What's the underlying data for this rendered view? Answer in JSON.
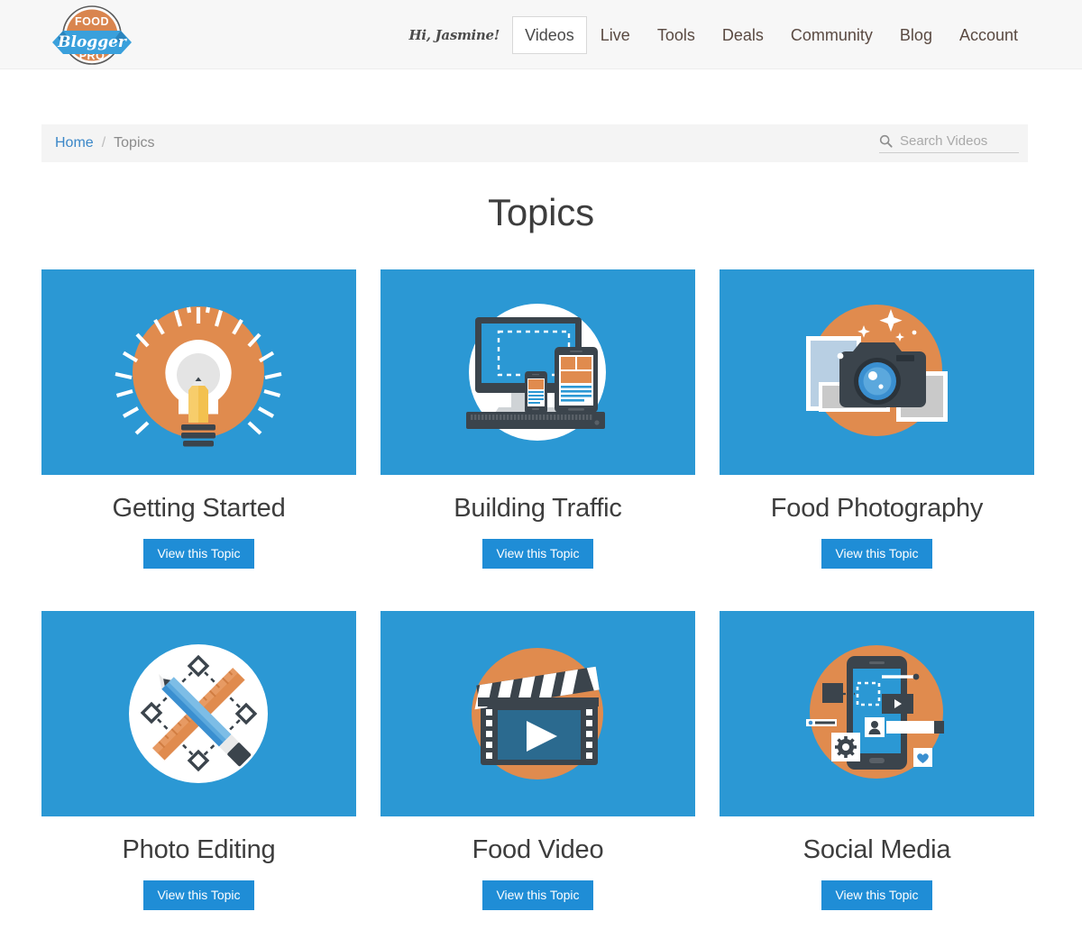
{
  "header": {
    "logo": {
      "name": "food-blogger-pro-logo",
      "line1": "FOOD",
      "line2": "Blogger",
      "line3": "PRO"
    },
    "greeting": "Hi, Jasmine!",
    "nav": [
      {
        "label": "Videos",
        "active": true
      },
      {
        "label": "Live",
        "active": false
      },
      {
        "label": "Tools",
        "active": false
      },
      {
        "label": "Deals",
        "active": false
      },
      {
        "label": "Community",
        "active": false
      },
      {
        "label": "Blog",
        "active": false
      },
      {
        "label": "Account",
        "active": false
      }
    ]
  },
  "breadcrumb": {
    "home": "Home",
    "separator": "/",
    "current": "Topics"
  },
  "search": {
    "placeholder": "Search Videos",
    "value": "",
    "icon": "search-icon"
  },
  "main": {
    "title": "Topics",
    "button_label": "View this Topic",
    "topics": [
      {
        "title": "Getting Started",
        "illustration": "lightbulb-pencil-icon",
        "button": "View this Topic"
      },
      {
        "title": "Building Traffic",
        "illustration": "responsive-devices-icon",
        "button": "View this Topic"
      },
      {
        "title": "Food Photography",
        "illustration": "camera-photos-icon",
        "button": "View this Topic"
      },
      {
        "title": "Photo Editing",
        "illustration": "pencil-ruler-icon",
        "button": "View this Topic"
      },
      {
        "title": "Food Video",
        "illustration": "clapperboard-play-icon",
        "button": "View this Topic"
      },
      {
        "title": "Social Media",
        "illustration": "smartphone-social-icon",
        "button": "View this Topic"
      }
    ]
  },
  "colors": {
    "card_blue": "#2b98d4",
    "button_blue": "#1f8dd6",
    "accent_orange": "#e08b4e",
    "dark_slate": "#3b444c",
    "header_bg": "#f7f7f7",
    "breadcrumb_bg": "#f4f4f4",
    "link_blue": "#3b87c8"
  }
}
